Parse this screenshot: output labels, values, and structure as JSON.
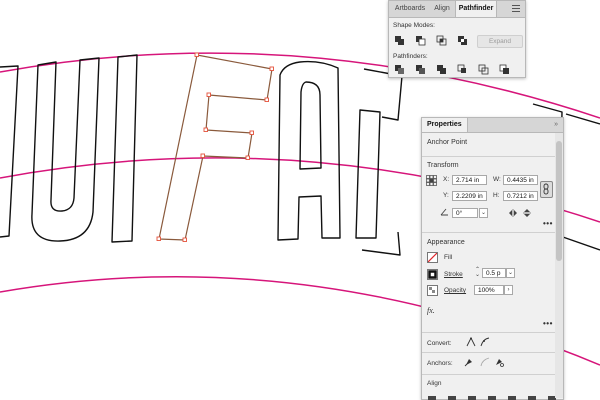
{
  "pathfinder_panel": {
    "tabs": [
      {
        "label": "Artboards"
      },
      {
        "label": "Align"
      },
      {
        "label": "Pathfinder"
      }
    ],
    "active_tab": "Pathfinder",
    "shape_modes_label": "Shape Modes:",
    "expand_label": "Expand",
    "pathfinders_label": "Pathfinders:",
    "shape_mode_icons": [
      "unite-icon",
      "minus-front-icon",
      "intersect-icon",
      "exclude-icon"
    ],
    "pathfinder_icons": [
      "divide-icon",
      "trim-icon",
      "merge-icon",
      "crop-icon",
      "outline-icon",
      "minus-back-icon"
    ]
  },
  "properties_panel": {
    "tab_label": "Properties",
    "selection_type": "Anchor Point",
    "transform": {
      "title": "Transform",
      "x_label": "X:",
      "x_value": "2.714 in",
      "y_label": "Y:",
      "y_value": "2.2209 in",
      "w_label": "W:",
      "w_value": "0.4435 in",
      "h_label": "H:",
      "h_value": "0.7212 in",
      "angle_value": "0°"
    },
    "appearance": {
      "title": "Appearance",
      "fill_label": "Fill",
      "stroke_label": "Stroke",
      "stroke_value": "0.5 p",
      "opacity_label": "Opacity",
      "opacity_value": "100%",
      "fx_label": "fx."
    },
    "convert_label": "Convert:",
    "anchors_label": "Anchors:",
    "align_label": "Align"
  },
  "colors": {
    "guide_magenta": "#d6157a",
    "selection_path": "#8a5a3c",
    "anchor_point": "#e5503a",
    "panel_bg": "#f0f0f0"
  }
}
